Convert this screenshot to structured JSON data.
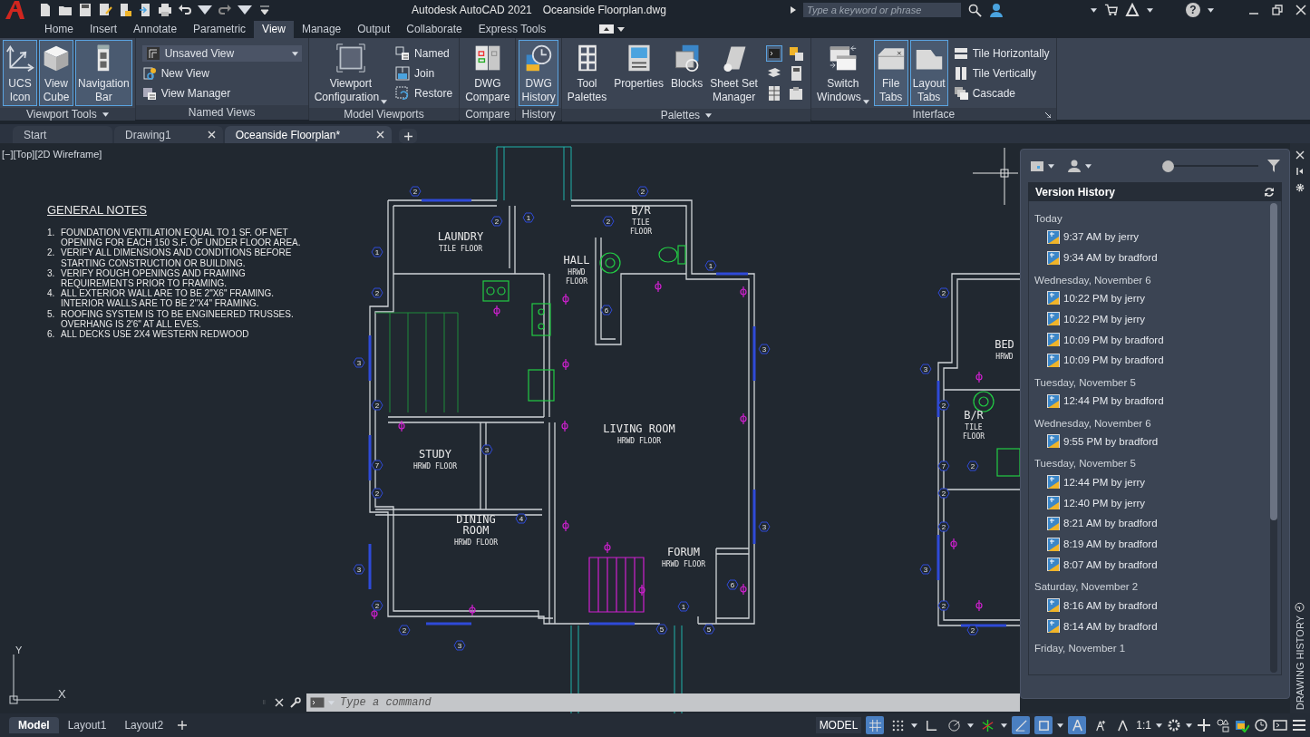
{
  "title_bar": {
    "app_title": "Autodesk AutoCAD 2021",
    "file_title": "Oceanside Floorplan.dwg",
    "search_placeholder": "Type a keyword or phrase",
    "help_label": "?"
  },
  "ribbon_tabs": [
    {
      "label": "Home",
      "selected": false
    },
    {
      "label": "Insert",
      "selected": false
    },
    {
      "label": "Annotate",
      "selected": false
    },
    {
      "label": "Parametric",
      "selected": false
    },
    {
      "label": "View",
      "selected": true
    },
    {
      "label": "Manage",
      "selected": false
    },
    {
      "label": "Output",
      "selected": false
    },
    {
      "label": "Collaborate",
      "selected": false
    },
    {
      "label": "Express Tools",
      "selected": false
    }
  ],
  "ribbon_panels": [
    {
      "title": "Viewport Tools",
      "has_menu": true,
      "items": [
        {
          "kind": "large",
          "lines": [
            "UCS",
            "Icon"
          ],
          "selected": true,
          "has_menu": false
        },
        {
          "kind": "large",
          "lines": [
            "View",
            "Cube"
          ],
          "selected": true,
          "has_menu": false
        },
        {
          "kind": "large",
          "lines": [
            "Navigation",
            "Bar"
          ],
          "selected": true,
          "has_menu": false
        }
      ]
    },
    {
      "title": "Named Views",
      "has_menu": false,
      "items": [
        {
          "kind": "combo",
          "label": "Unsaved View"
        },
        {
          "kind": "small",
          "label": "New View"
        },
        {
          "kind": "small",
          "label": "View Manager"
        }
      ]
    },
    {
      "title": "Model Viewports",
      "has_menu": false,
      "items": [
        {
          "kind": "large",
          "lines": [
            "Viewport",
            "Configuration"
          ],
          "selected": false,
          "has_menu": true
        },
        {
          "kind": "small",
          "label": "Named"
        },
        {
          "kind": "small",
          "label": "Join"
        },
        {
          "kind": "small",
          "label": "Restore"
        }
      ]
    },
    {
      "title": "Compare",
      "has_menu": false,
      "items": [
        {
          "kind": "large",
          "lines": [
            "DWG",
            "Compare"
          ],
          "selected": false,
          "has_menu": false
        }
      ]
    },
    {
      "title": "History",
      "has_menu": false,
      "items": [
        {
          "kind": "large",
          "lines": [
            "DWG",
            "History"
          ],
          "selected": true,
          "has_menu": false
        }
      ]
    },
    {
      "title": "Palettes",
      "has_menu": true,
      "items": [
        {
          "kind": "large",
          "lines": [
            "Tool",
            "Palettes"
          ],
          "selected": false,
          "has_menu": false
        },
        {
          "kind": "large",
          "lines": [
            "Properties"
          ],
          "selected": false,
          "has_menu": false
        },
        {
          "kind": "large",
          "lines": [
            "Blocks"
          ],
          "selected": false,
          "has_menu": false
        },
        {
          "kind": "large",
          "lines": [
            "Sheet Set",
            "Manager"
          ],
          "selected": false,
          "has_menu": false
        },
        {
          "kind": "icon_grid"
        }
      ]
    },
    {
      "title": "Interface",
      "has_menu": false,
      "items": [
        {
          "kind": "large",
          "lines": [
            "Switch",
            "Windows"
          ],
          "selected": false,
          "has_menu": true
        },
        {
          "kind": "large",
          "lines": [
            "File",
            "Tabs"
          ],
          "selected": true,
          "has_menu": false
        },
        {
          "kind": "large",
          "lines": [
            "Layout",
            "Tabs"
          ],
          "selected": true,
          "has_menu": false
        },
        {
          "kind": "small",
          "label": "Tile Horizontally"
        },
        {
          "kind": "small",
          "label": "Tile Vertically"
        },
        {
          "kind": "small",
          "label": "Cascade"
        }
      ]
    }
  ],
  "doc_tabs": [
    {
      "label": "Start",
      "selected": false,
      "closable": false
    },
    {
      "label": "Drawing1",
      "selected": false,
      "closable": true
    },
    {
      "label": "Oceanside Floorplan*",
      "selected": true,
      "closable": true
    }
  ],
  "viewport_label": "[−][Top][2D Wireframe]",
  "notes": {
    "heading": "GENERAL NOTES",
    "items": [
      {
        "number": "1.",
        "lines": [
          "FOUNDATION VENTILATION EQUAL TO 1 SF. OF NET",
          "OPENING FOR EACH 150 S.F. OF UNDER FLOOR AREA."
        ]
      },
      {
        "number": "2.",
        "lines": [
          "VERIFY ALL DIMENSIONS AND CONDITIONS BEFORE",
          "STARTING CONSTRUCTION OR BUILDING."
        ]
      },
      {
        "number": "3.",
        "lines": [
          "VERIFY ROUGH OPENINGS AND FRAMING",
          "REQUIREMENTS PRIOR TO FRAMING."
        ]
      },
      {
        "number": "4.",
        "lines": [
          "ALL EXTERIOR WALL ARE TO BE 2\"X6\" FRAMING.",
          "INTERIOR WALLS ARE TO BE 2\"X4\" FRAMING."
        ]
      },
      {
        "number": "5.",
        "lines": [
          "ROOFING SYSTEM IS TO BE ENGINEERED TRUSSES.",
          "OVERHANG IS 2'6\" AT ALL EVES."
        ]
      },
      {
        "number": "6.",
        "lines": [
          "ALL DECKS USE 2X4 WESTERN REDWOOD"
        ]
      }
    ]
  },
  "plan": {
    "rooms": [
      {
        "name": [
          "LAUNDRY"
        ],
        "floor": [
          "TILE FLOOR"
        ]
      },
      {
        "name": [
          "B/R"
        ],
        "floor": [
          "TILE",
          "FLOOR"
        ]
      },
      {
        "name": [
          "HALL"
        ],
        "floor": [
          "HRWD",
          "FLOOR"
        ]
      },
      {
        "name": [
          "STUDY"
        ],
        "floor": [
          "HRWD FLOOR"
        ]
      },
      {
        "name": [
          "LIVING ROOM"
        ],
        "floor": [
          "HRWD FLOOR"
        ]
      },
      {
        "name": [
          "DINING",
          "ROOM"
        ],
        "floor": [
          "HRWD FLOOR"
        ]
      },
      {
        "name": [
          "FORUM"
        ],
        "floor": [
          "HRWD FLOOR"
        ]
      },
      {
        "name": [
          "BED"
        ],
        "floor": [
          "HRWD"
        ]
      },
      {
        "name": [
          "B/R"
        ],
        "floor": [
          "TILE",
          "FLOOR"
        ]
      }
    ],
    "tags": [
      "2",
      "2",
      "1",
      "2",
      "2",
      "1",
      "2",
      "1",
      "6",
      "3",
      "3",
      "2",
      "3",
      "7",
      "2",
      "4",
      "3",
      "3",
      "2",
      "6",
      "1",
      "2",
      "5",
      "5",
      "3",
      "2",
      "3",
      "2",
      "7",
      "2",
      "2",
      "2",
      "3",
      "2",
      "2"
    ]
  },
  "ucs_labels": [
    "Y",
    "X"
  ],
  "history": {
    "title": "Version History",
    "slider": {
      "level": 0
    },
    "groups": [
      {
        "date": "Today",
        "entries": [
          "9:37 AM by jerry",
          "9:34 AM by bradford"
        ]
      },
      {
        "date": "Wednesday, November 6",
        "entries": [
          "10:22 PM by jerry",
          "10:22 PM by jerry",
          "10:09 PM by bradford",
          "10:09 PM by bradford"
        ]
      },
      {
        "date": "Tuesday, November 5",
        "entries": [
          "12:44 PM by bradford"
        ]
      },
      {
        "date": "Wednesday, November 6",
        "entries": [
          "9:55 PM by bradford"
        ]
      },
      {
        "date": "Tuesday, November 5",
        "entries": [
          "12:44 PM by jerry",
          "12:40 PM by jerry",
          "8:21 AM by bradford",
          "8:19 AM by bradford",
          "8:07 AM by bradford"
        ]
      },
      {
        "date": "Saturday, November 2",
        "entries": [
          "8:16 AM by bradford",
          "8:14 AM by bradford"
        ]
      },
      {
        "date": "Friday, November 1"
      }
    ],
    "side_label": "DRAWING HISTORY"
  },
  "command": {
    "placeholder": "Type a command"
  },
  "layout_tabs": [
    {
      "label": "Model",
      "selected": true
    },
    {
      "label": "Layout1",
      "selected": false
    },
    {
      "label": "Layout2",
      "selected": false
    }
  ],
  "status": {
    "model_label": "MODEL",
    "scale": "1:1",
    "toggles": [
      {
        "kind": "grid",
        "on": true
      },
      {
        "kind": "snap",
        "on": false
      },
      {
        "kind": "ortho",
        "on": false
      },
      {
        "kind": "polar",
        "on": false
      },
      {
        "kind": "isodraft",
        "on": false
      },
      {
        "kind": "otrack",
        "on": true
      },
      {
        "kind": "osnap",
        "on": true
      },
      {
        "kind": "annovis",
        "on": true
      },
      {
        "kind": "autoscale",
        "on": false
      },
      {
        "kind": "annoscale",
        "on": false
      }
    ]
  }
}
